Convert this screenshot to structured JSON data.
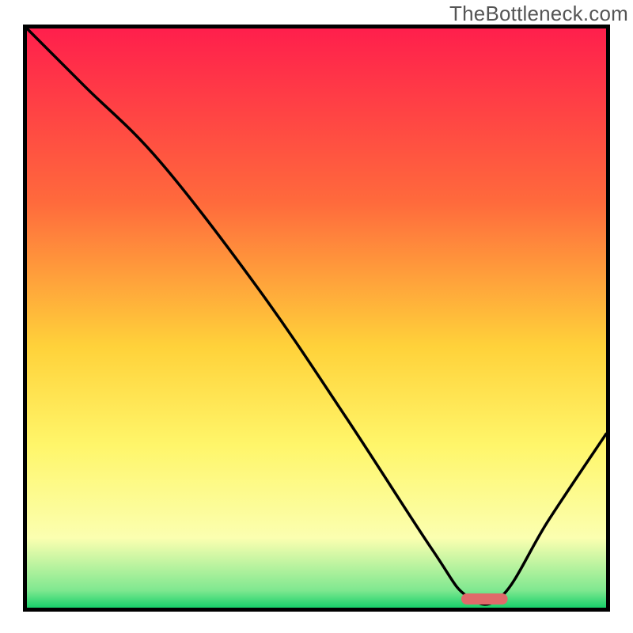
{
  "watermark": "TheBottleneck.com",
  "chart_data": {
    "type": "line",
    "title": "",
    "xlabel": "",
    "ylabel": "",
    "xlim": [
      0,
      100
    ],
    "ylim": [
      0,
      100
    ],
    "gradient_stops": [
      {
        "offset": 0,
        "color": "#ff1f4c"
      },
      {
        "offset": 30,
        "color": "#ff6a3c"
      },
      {
        "offset": 55,
        "color": "#ffd23a"
      },
      {
        "offset": 72,
        "color": "#fff66a"
      },
      {
        "offset": 88,
        "color": "#fbffb0"
      },
      {
        "offset": 97,
        "color": "#7fe890"
      },
      {
        "offset": 100,
        "color": "#18d06a"
      }
    ],
    "series": [
      {
        "name": "bottleneck-curve",
        "x": [
          0,
          10,
          23,
          40,
          55,
          70,
          76,
          82,
          90,
          100
        ],
        "y": [
          100,
          90,
          77,
          55,
          33,
          10,
          2,
          2,
          15,
          30
        ]
      }
    ],
    "marker": {
      "name": "optimal-range",
      "x_start": 75,
      "x_end": 83,
      "y": 1.5,
      "color": "#e06a6a"
    }
  }
}
